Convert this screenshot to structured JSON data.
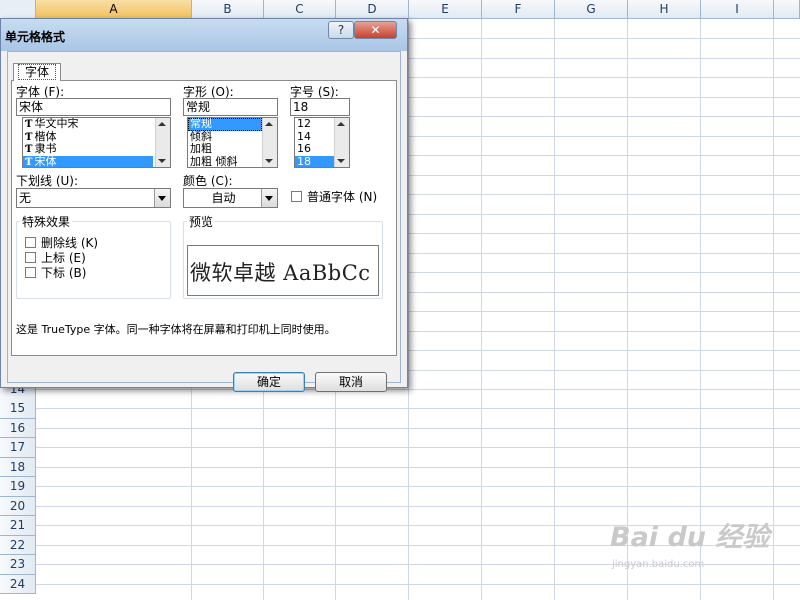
{
  "spreadsheet": {
    "columns": [
      "A",
      "B",
      "C",
      "D",
      "E",
      "F",
      "G",
      "H",
      "I"
    ],
    "active_column": "A",
    "visible_row_numbers": [
      "14",
      "15",
      "16",
      "17",
      "18",
      "19",
      "20",
      "21",
      "22",
      "23",
      "24"
    ]
  },
  "dialog": {
    "title": "单元格格式",
    "help_button": "?",
    "close_button": "✕",
    "tab_font": "字体",
    "font_label": "字体 (F):",
    "font_value": "宋体",
    "font_list": [
      "华文中宋",
      "楷体",
      "隶书",
      "宋体"
    ],
    "font_list_selected": "宋体",
    "style_label": "字形 (O):",
    "style_value": "常规",
    "style_list": [
      "常规",
      "倾斜",
      "加粗",
      "加粗 倾斜"
    ],
    "style_list_selected": "常规",
    "size_label": "字号 (S):",
    "size_value": "18",
    "size_list": [
      "12",
      "14",
      "16",
      "18"
    ],
    "size_list_selected": "18",
    "underline_label": "下划线 (U):",
    "underline_value": "无",
    "color_label": "颜色 (C):",
    "color_value": "自动",
    "normal_font_label": "普通字体 (N)",
    "effects_title": "特殊效果",
    "effects": [
      "删除线 (K)",
      "上标 (E)",
      "下标 (B)"
    ],
    "preview_title": "预览",
    "preview_text": "微软卓越  AaBbCc",
    "note": "这是 TrueType 字体。同一种字体将在屏幕和打印机上同时使用。",
    "ok_button": "确定",
    "cancel_button": "取消"
  },
  "watermark": {
    "logo": "Bai du 经验",
    "site": "jingyan.baidu.com"
  },
  "colors": {
    "selection": "#3399ff",
    "active_header": "#f1c15f",
    "title_bar": "#a9c6e6",
    "close_button": "#c7412d"
  }
}
